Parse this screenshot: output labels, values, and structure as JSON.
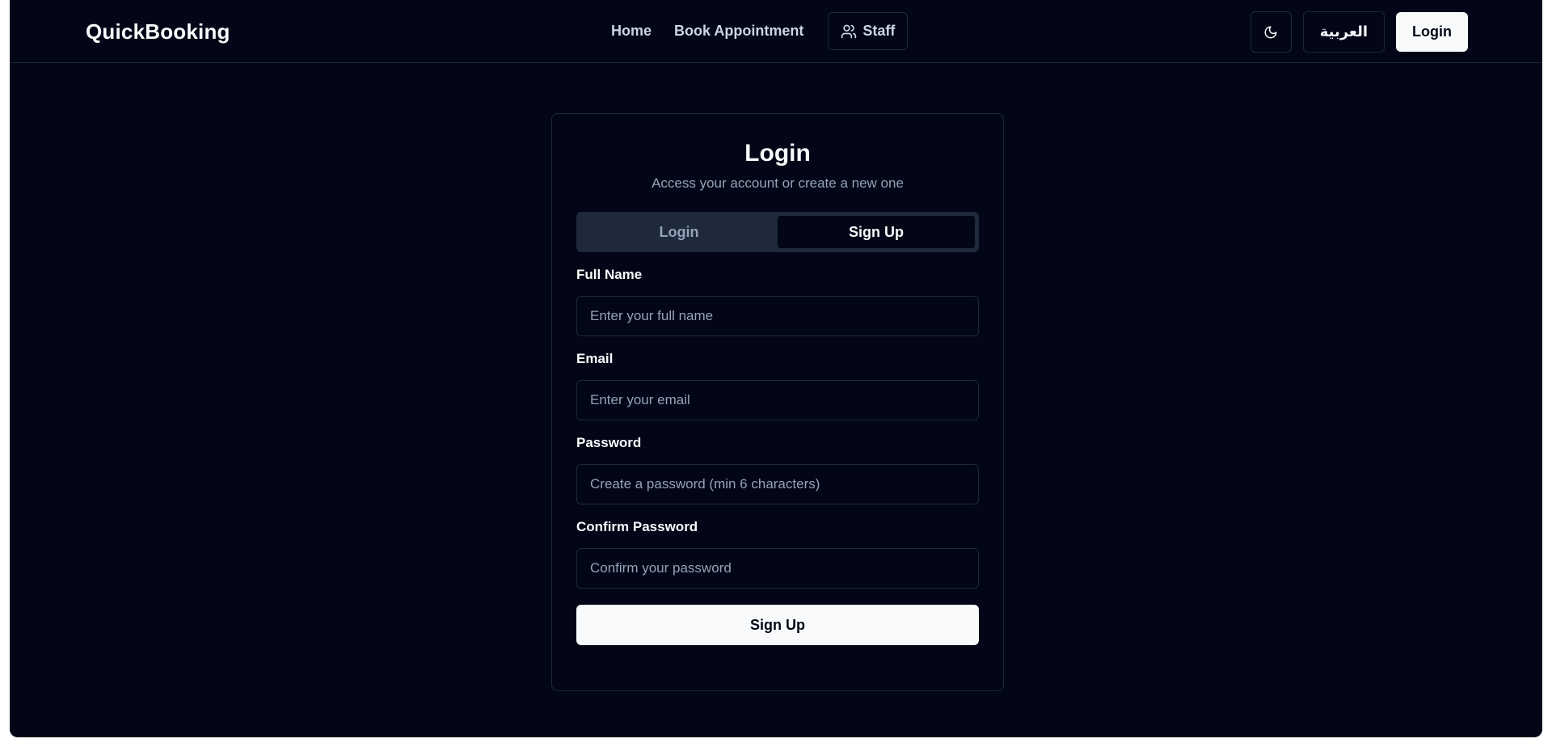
{
  "navbar": {
    "brand": "QuickBooking",
    "links": {
      "home": "Home",
      "book": "Book Appointment",
      "staff": "Staff"
    },
    "theme_icon": "moon-icon",
    "language_label": "العربية",
    "login_label": "Login"
  },
  "card": {
    "title": "Login",
    "subtitle": "Access your account or create a new one",
    "tabs": {
      "login": "Login",
      "signup": "Sign Up",
      "active": "signup"
    },
    "fields": {
      "full_name": {
        "label": "Full Name",
        "placeholder": "Enter your full name"
      },
      "email": {
        "label": "Email",
        "placeholder": "Enter your email"
      },
      "password": {
        "label": "Password",
        "placeholder": "Create a password (min 6 characters)"
      },
      "confirm_password": {
        "label": "Confirm Password",
        "placeholder": "Confirm your password"
      }
    },
    "submit_label": "Sign Up"
  },
  "colors": {
    "background": "#020617",
    "border": "#1e293b",
    "foreground": "#f8fafc",
    "muted": "#94a3b8"
  }
}
